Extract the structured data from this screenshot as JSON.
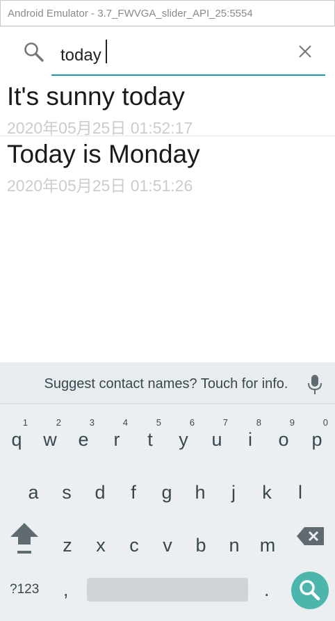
{
  "window": {
    "title": "Android Emulator - 3.7_FWVGA_slider_API_25:5554"
  },
  "search": {
    "query": "today",
    "search_icon": "search-icon",
    "clear_icon": "close-icon"
  },
  "results": [
    {
      "title": "It's sunny today",
      "date": "2020年05月25日 01:52:17"
    },
    {
      "title": "Today is Monday",
      "date": "2020年05月25日 01:51:26"
    }
  ],
  "keyboard": {
    "suggestion": "Suggest contact names? Touch for info.",
    "mic_icon": "microphone-icon",
    "row1": [
      {
        "letter": "q",
        "hint": "1"
      },
      {
        "letter": "w",
        "hint": "2"
      },
      {
        "letter": "e",
        "hint": "3"
      },
      {
        "letter": "r",
        "hint": "4"
      },
      {
        "letter": "t",
        "hint": "5"
      },
      {
        "letter": "y",
        "hint": "6"
      },
      {
        "letter": "u",
        "hint": "7"
      },
      {
        "letter": "i",
        "hint": "8"
      },
      {
        "letter": "o",
        "hint": "9"
      },
      {
        "letter": "p",
        "hint": "0"
      }
    ],
    "row2": [
      "a",
      "s",
      "d",
      "f",
      "g",
      "h",
      "j",
      "k",
      "l"
    ],
    "row3": [
      "z",
      "x",
      "c",
      "v",
      "b",
      "n",
      "m"
    ],
    "symbols_label": "?123",
    "comma_label": ",",
    "period_label": ".",
    "shift_icon": "shift-icon",
    "backspace_icon": "backspace-icon",
    "action_icon": "search-icon",
    "accent_color": "#4db6ac"
  }
}
